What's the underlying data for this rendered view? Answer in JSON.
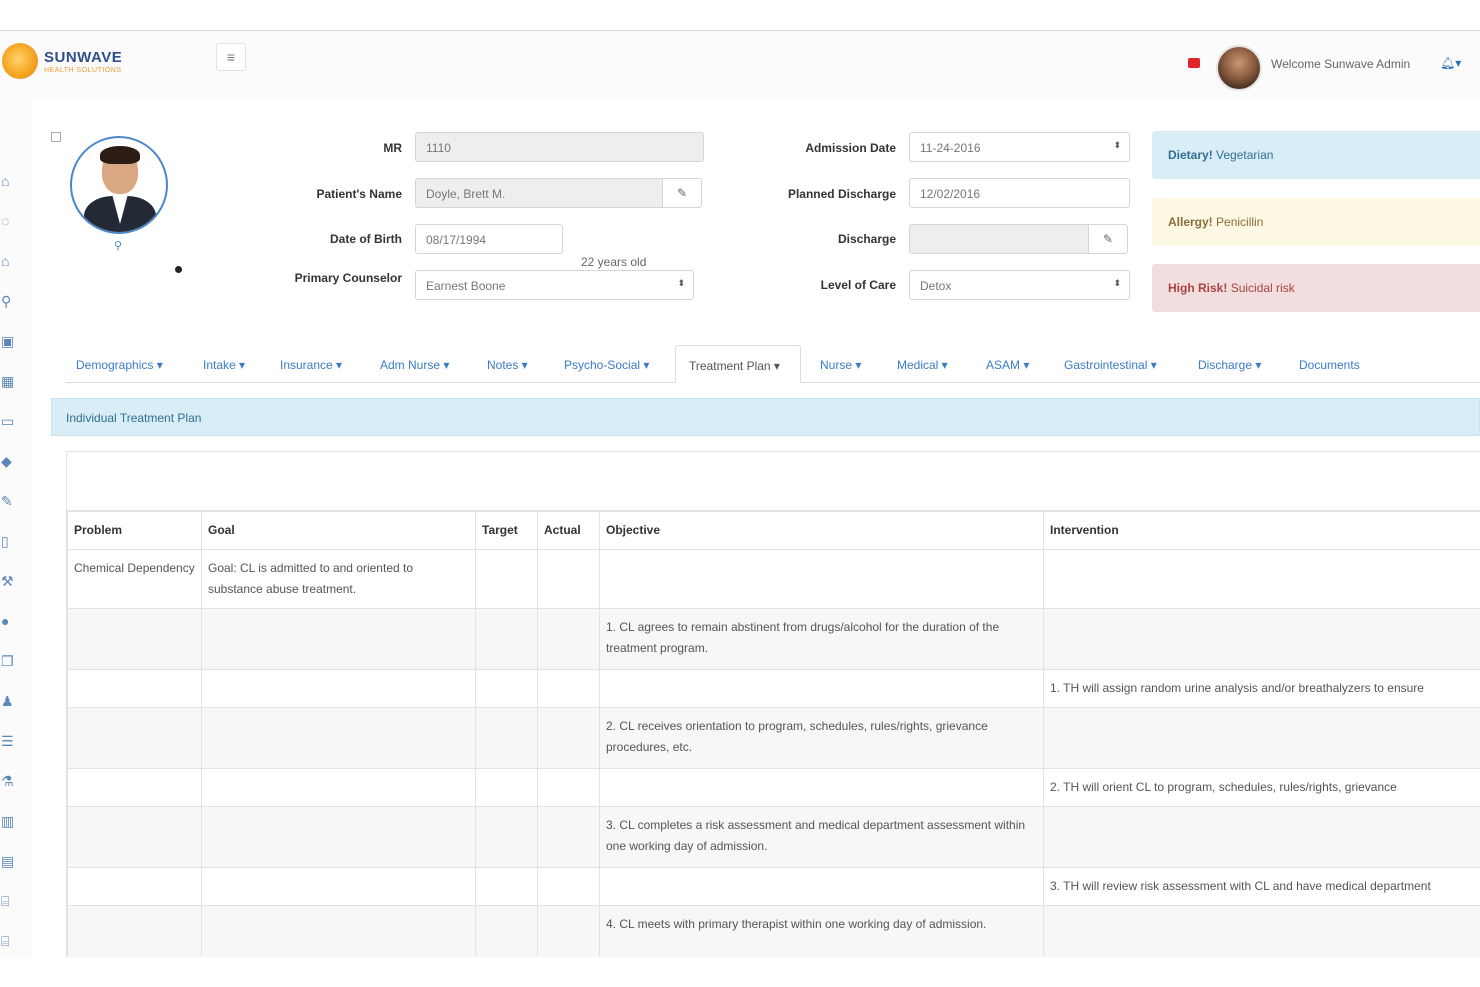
{
  "header": {
    "logo_name": "SUNWAVE",
    "logo_sub": "HEALTH SOLUTIONS",
    "menu_icon": "hamburger-icon",
    "welcome": "Welcome Sunwave Admin",
    "bell_icon": "bell-icon"
  },
  "sidebar": {
    "icons": [
      "home-icon",
      "tag-icon",
      "home-icon",
      "search-icon",
      "id-card-icon",
      "calendar-icon",
      "calendar-icon",
      "pills-icon",
      "edit-icon",
      "clipboard-icon",
      "gavel-icon",
      "circle-icon",
      "copy-icon",
      "user-icon",
      "list-icon",
      "flask-icon",
      "columns-icon",
      "table-icon",
      "bank-icon",
      "bank-icon"
    ]
  },
  "patient": {
    "mr_label": "MR",
    "mr_value": "1110",
    "name_label": "Patient's Name",
    "name_value": "Doyle, Brett M.",
    "dob_label": "Date of Birth",
    "dob_value": "08/17/1994",
    "age": "22 years old",
    "counselor_label": "Primary Counselor",
    "counselor_value": "Earnest Boone",
    "admission_label": "Admission Date",
    "admission_value": "11-24-2016",
    "planned_label": "Planned Discharge",
    "planned_value": "12/02/2016",
    "discharge_label": "Discharge",
    "discharge_value": "",
    "loc_label": "Level of Care",
    "loc_value": "Detox"
  },
  "alerts": {
    "dietary_label": "Dietary!",
    "dietary_value": "Vegetarian",
    "allergy_label": "Allergy!",
    "allergy_value": "Penicillin",
    "risk_label": "High Risk!",
    "risk_value": "Suicidal risk"
  },
  "tabs": [
    "Demographics ▾",
    "Intake ▾",
    "Insurance ▾",
    "Adm Nurse ▾",
    "Notes ▾",
    "Psycho-Social ▾",
    "Treatment Plan ▾",
    "Nurse ▾",
    "Medical ▾",
    "ASAM ▾",
    "Gastrointestinal ▾",
    "Discharge ▾",
    "Documents"
  ],
  "panel_title": "Individual Treatment Plan",
  "table": {
    "headers": [
      "Problem",
      "Goal",
      "Target",
      "Actual",
      "Objective",
      "Intervention"
    ],
    "rows": [
      [
        "Chemical Dependency",
        "Goal: CL is admitted to and oriented to substance abuse treatment.",
        "",
        "",
        "",
        ""
      ],
      [
        "",
        "",
        "",
        "",
        "1. CL agrees to remain abstinent from drugs/alcohol for the duration of the treatment program.",
        ""
      ],
      [
        "",
        "",
        "",
        "",
        "",
        "1. TH will assign random urine analysis and/or breathalyzers to ensure"
      ],
      [
        "",
        "",
        "",
        "",
        "2. CL receives orientation to program, schedules, rules/rights, grievance procedures, etc.",
        ""
      ],
      [
        "",
        "",
        "",
        "",
        "",
        "2. TH will orient CL to program, schedules, rules/rights, grievance"
      ],
      [
        "",
        "",
        "",
        "",
        "3. CL completes a risk assessment and medical department assessment within one working day of admission.",
        ""
      ],
      [
        "",
        "",
        "",
        "",
        "",
        "3. TH will review risk assessment with CL and have medical department"
      ],
      [
        "",
        "",
        "",
        "",
        "4. CL meets with primary therapist within one working day of admission.",
        ""
      ]
    ]
  }
}
